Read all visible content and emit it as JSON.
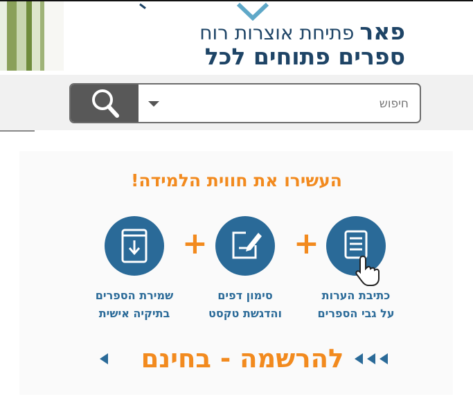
{
  "colors": {
    "brand_navy": "#1e4466",
    "accent_orange": "#f28a1e",
    "icon_blue": "#2a6a98",
    "search_button": "#585858"
  },
  "brand": {
    "logo": "פאר",
    "tagline": "פתיחת אוצרות רוח",
    "subtitle": "ספרים פתוחים לכל"
  },
  "search": {
    "placeholder": "חיפוש",
    "icon": "magnifier-icon",
    "dropdown_icon": "caret-down-icon"
  },
  "promo": {
    "headline": "העשירו את חווית הלמידה!",
    "features": [
      {
        "line1": "כתיבת הערות",
        "line2": "על גבי הספרים",
        "icon": "notes-list-icon"
      },
      {
        "line1": "סימון דפים",
        "line2": "והדגשת טקסט",
        "icon": "edit-pencil-icon"
      },
      {
        "line1": "שמירת הספרים",
        "line2": "בתיקיה אישית",
        "icon": "tablet-download-icon"
      }
    ],
    "plus": "+",
    "signup": "להרשמה - בחינם"
  }
}
